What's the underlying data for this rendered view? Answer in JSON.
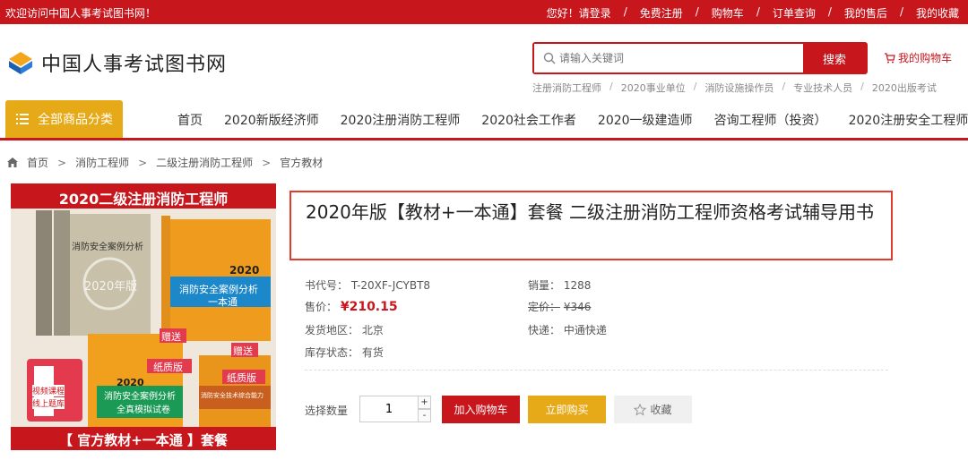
{
  "topbar": {
    "welcome": "欢迎访问中国人事考试图书网！",
    "links": [
      "您好！请登录",
      "免费注册",
      "购物车",
      "订单查询",
      "我的售后",
      "我的收藏"
    ]
  },
  "header": {
    "logo_text": "中国人事考试图书网",
    "search_placeholder": "请输入关键词",
    "search_button": "搜索",
    "cart_label": "我的购物车",
    "hot_keywords": [
      "注册消防工程师",
      "2020事业单位",
      "消防设施操作员",
      "专业技术人员",
      "2020出版考试"
    ]
  },
  "nav": {
    "category_button": "全部商品分类",
    "items": [
      "首页",
      "2020新版经济师",
      "2020注册消防工程师",
      "2020社会工作者",
      "2020一级建造师",
      "咨询工程师（投资）",
      "2020注册安全工程师"
    ]
  },
  "breadcrumb": [
    "首页",
    "消防工程师",
    "二级注册消防工程师",
    "官方教材"
  ],
  "product": {
    "image_text": {
      "top_banner": "2020二级注册消防工程师",
      "bottom_banner": "【 官方教材+一本通 】套餐",
      "book_a": "消防安全案例分析",
      "book_a_year": "2020年版",
      "book_b": "消防安全案例分析",
      "book_b_sub": "一本通",
      "book_c": "消防安全案例分析",
      "book_c_sub": "全真模拟试卷",
      "book_d": "消防安全技术综合能力",
      "year": "2020",
      "paper_tag": "纸质版",
      "gift_tag": "赠送",
      "video_tag": "视频课程",
      "online_tag": "线上题库"
    },
    "title": "2020年版【教材+一本通】套餐 二级注册消防工程师资格考试辅导用书",
    "code_label": "书代号：",
    "code_value": "T-20XF-JCYBT8",
    "sales_label": "销量：",
    "sales_value": "1288",
    "price_label": "售价：",
    "price_value": "¥210.15",
    "list_price_label": "定价：",
    "list_price_value": "¥346",
    "ship_from_label": "发货地区：",
    "ship_from_value": "北京",
    "express_label": "快递：",
    "express_value": "中通快递",
    "stock_label": "库存状态：",
    "stock_value": "有货",
    "qty_label": "选择数量",
    "qty_value": "1",
    "plus": "+",
    "minus": "-",
    "add_cart": "加入购物车",
    "buy_now": "立即购买",
    "favorite": "收藏"
  },
  "colors": {
    "brand_red": "#c8161d",
    "accent_gold": "#e6a918"
  }
}
